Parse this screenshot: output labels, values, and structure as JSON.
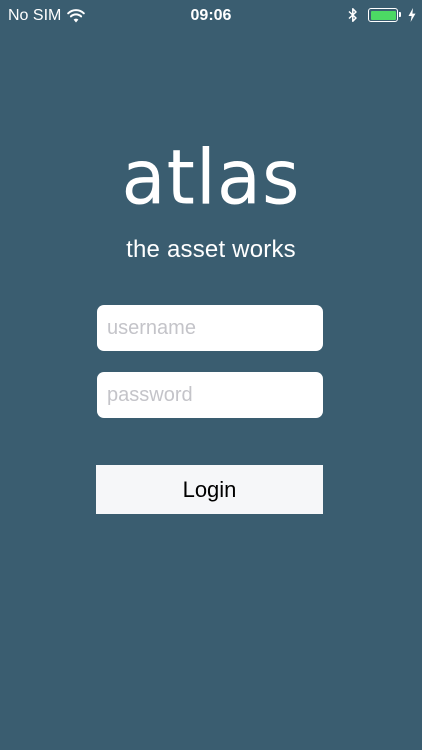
{
  "status_bar": {
    "carrier": "No SIM",
    "time": "09:06",
    "battery_level": 1.0,
    "battery_color": "#4cd964"
  },
  "icons": {
    "wifi": "wifi-icon",
    "bluetooth": "bluetooth-icon",
    "battery": "battery-icon",
    "charging": "charging-bolt-icon"
  },
  "app": {
    "logo": "atlas",
    "tagline": "the asset works"
  },
  "login_form": {
    "username": {
      "value": "",
      "placeholder": "username"
    },
    "password": {
      "value": "",
      "placeholder": "password"
    },
    "login_label": "Login"
  },
  "colors": {
    "background": "#3a5d70",
    "button_background": "#f6f7f9",
    "placeholder": "#c4c4c9"
  }
}
